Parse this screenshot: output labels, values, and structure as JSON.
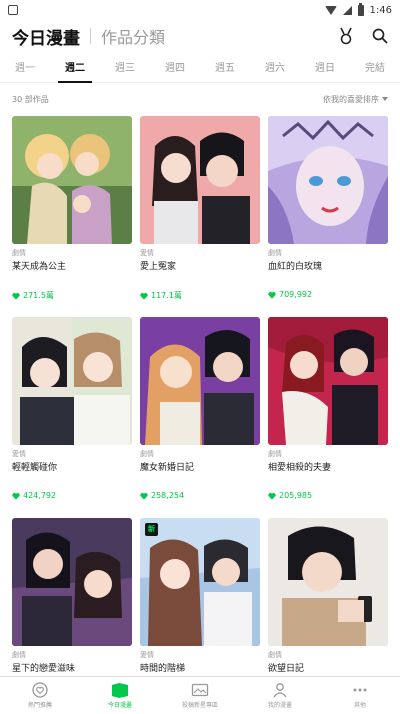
{
  "status": {
    "time": "1:46"
  },
  "header": {
    "title": "今日漫畫",
    "title2": "作品分類"
  },
  "day_tabs": [
    {
      "label": "週一"
    },
    {
      "label": "週二",
      "active": true
    },
    {
      "label": "週三"
    },
    {
      "label": "週四"
    },
    {
      "label": "週五"
    },
    {
      "label": "週六"
    },
    {
      "label": "週日"
    },
    {
      "label": "完結"
    }
  ],
  "list": {
    "count": "30 部作品",
    "sort_label": "依我的喜愛排序"
  },
  "cards": [
    {
      "genre": "劇情",
      "title": "某天成為公主",
      "likes": "271.5萬"
    },
    {
      "genre": "愛情",
      "title": "愛上冤家",
      "likes": "117.1萬"
    },
    {
      "genre": "劇情",
      "title": "血紅的白玫瑰",
      "likes": "709,992"
    },
    {
      "genre": "愛情",
      "title": "輕輕觸碰你",
      "likes": "424,792"
    },
    {
      "genre": "劇情",
      "title": "魔女新婚日記",
      "likes": "258,254"
    },
    {
      "genre": "劇情",
      "title": "相愛相殺的夫妻",
      "likes": "205,985"
    },
    {
      "genre": "劇情",
      "title": "星下的戀愛滋味",
      "likes": ""
    },
    {
      "genre": "愛情",
      "title": "時間的階梯",
      "likes": ""
    },
    {
      "genre": "劇情",
      "title": "欲望日記",
      "likes": ""
    }
  ],
  "badge": {
    "new_label": "新"
  },
  "bottom_nav": [
    {
      "label": "熱門推薦",
      "icon": "heart-circle-icon"
    },
    {
      "label": "今日漫畫",
      "icon": "book-icon",
      "active": true
    },
    {
      "label": "投稿新星專區",
      "icon": "image-frame-icon"
    },
    {
      "label": "我的漫畫",
      "icon": "person-icon"
    },
    {
      "label": "其他",
      "icon": "more-dots-icon"
    }
  ],
  "colors": {
    "accent": "#00c84a",
    "text": "#222222",
    "muted": "#999999"
  }
}
